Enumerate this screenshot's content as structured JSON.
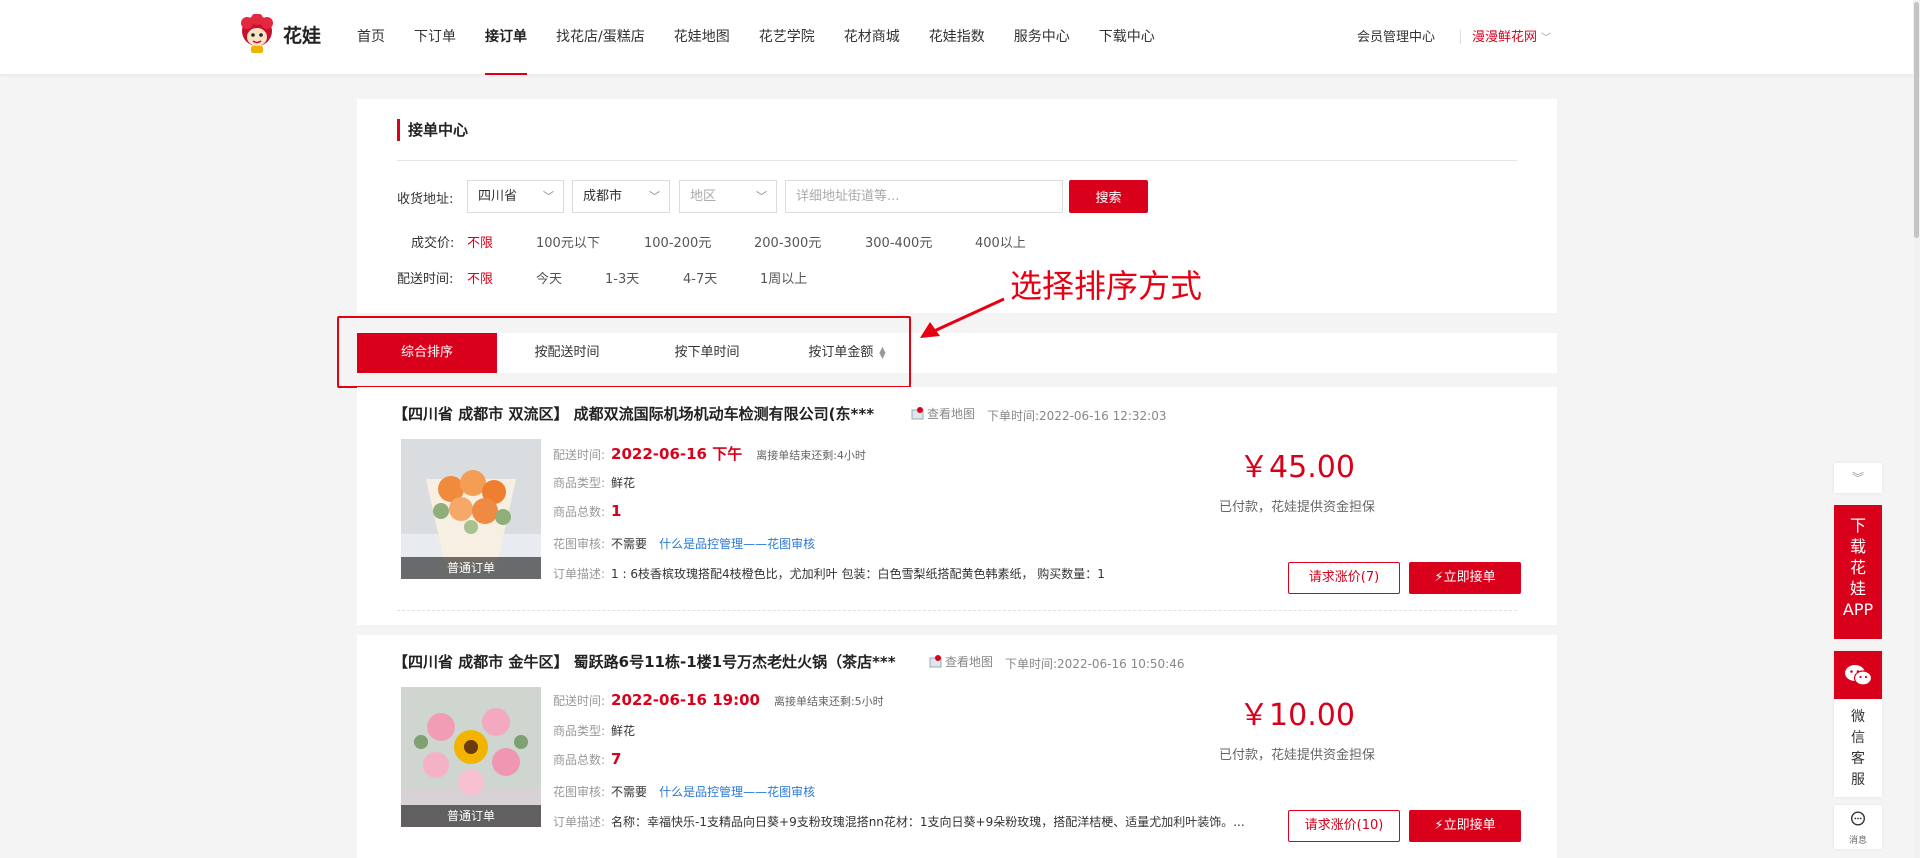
{
  "header": {
    "logo_text": "花娃",
    "nav": [
      "首页",
      "下订单",
      "接订单",
      "找花店/蛋糕店",
      "花娃地图",
      "花艺学院",
      "花材商城",
      "花娃指数",
      "服务中心",
      "下载中心"
    ],
    "active_nav_index": 2,
    "member_link": "会员管理中心",
    "site_select": "漫漫鲜花网"
  },
  "filter": {
    "title": "接单中心",
    "address_label": "收货地址:",
    "province": "四川省",
    "city": "成都市",
    "district_placeholder": "地区",
    "street_placeholder": "详细地址街道等...",
    "search_button": "搜索",
    "price_label": "成交价:",
    "price_options": [
      "不限",
      "100元以下",
      "100-200元",
      "200-300元",
      "300-400元",
      "400以上"
    ],
    "delivery_label": "配送时间:",
    "delivery_options": [
      "不限",
      "今天",
      "1-3天",
      "4-7天",
      "1周以上"
    ]
  },
  "sort": {
    "tabs": [
      "综合排序",
      "按配送时间",
      "按下单时间",
      "按订单金额"
    ],
    "active_index": 0
  },
  "annotation": "选择排序方式",
  "orders": [
    {
      "title": "【四川省 成都市 双流区】 成都双流国际机场机动车检测有限公司(东***",
      "map_link": "查看地图",
      "order_time": "下单时间:2022-06-16 12:32:03",
      "photo_tag": "普通订单",
      "delivery_label": "配送时间:",
      "delivery_value": "2022-06-16 下午",
      "deadline": "离接单结束还剩:4小时",
      "type_label": "商品类型:",
      "type_value": "鲜花",
      "count_label": "商品总数:",
      "count_value": "1",
      "review_label": "花图审核:",
      "review_value": "不需要",
      "review_link": "什么是品控管理——花图审核",
      "desc_label": "订单描述:",
      "desc_value": "1 : 6枝香槟玫瑰搭配4枝橙色比，尤加利叶 包装：白色雪梨纸搭配黄色韩素纸， 购买数量：1",
      "price": "￥45.00",
      "paid_note": "已付款，花娃提供资金担保",
      "ask_button": "请求涨价(7)",
      "take_button": "立即接单"
    },
    {
      "title": "【四川省 成都市 金牛区】 蜀跃路6号11栋-1楼1号万杰老灶火锅（茶店***",
      "map_link": "查看地图",
      "order_time": "下单时间:2022-06-16 10:50:46",
      "photo_tag": "普通订单",
      "delivery_label": "配送时间:",
      "delivery_value": "2022-06-16 19:00",
      "deadline": "离接单结束还剩:5小时",
      "type_label": "商品类型:",
      "type_value": "鲜花",
      "count_label": "商品总数:",
      "count_value": "7",
      "review_label": "花图审核:",
      "review_value": "不需要",
      "review_link": "什么是品控管理——花图审核",
      "desc_label": "订单描述:",
      "desc_value": "名称：幸福快乐-1支精品向日葵+9支粉玫瑰混搭nn花材：1支向日葵+9朵粉玫瑰，搭配洋桔梗、适量尤加利叶装饰。...",
      "price": "￥10.00",
      "paid_note": "已付款，花娃提供资金担保",
      "ask_button": "请求涨价(10)",
      "take_button": "立即接单"
    }
  ],
  "float": {
    "collapse_icon": "chevron-double-down-icon",
    "app_text": [
      "下",
      "载",
      "花",
      "娃",
      "APP"
    ],
    "wechat_text": [
      "微",
      "信",
      "客",
      "服"
    ],
    "message_text": "消息"
  },
  "colors": {
    "brand_red": "#d9001b",
    "link_blue": "#2b79d4"
  }
}
